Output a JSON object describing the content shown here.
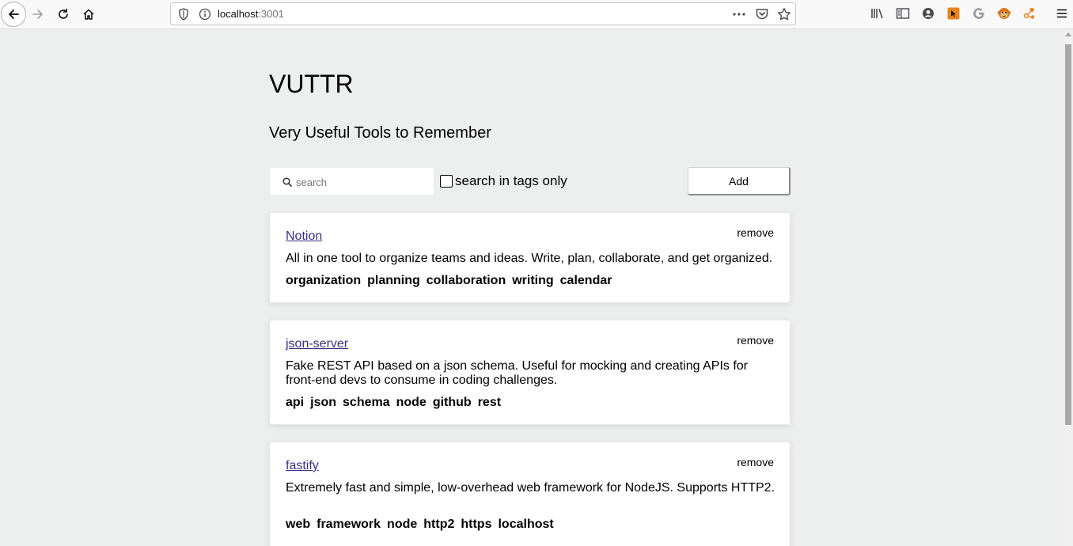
{
  "browser": {
    "url_host": "localhost",
    "url_port": ":3001"
  },
  "page": {
    "title": "VUTTR",
    "subtitle": "Very Useful Tools to Remember"
  },
  "controls": {
    "search_placeholder": "search",
    "tags_only_label": "search in tags only",
    "tags_only_checked": false,
    "add_label": "Add"
  },
  "tools": [
    {
      "name": "Notion",
      "remove_label": "remove",
      "description": "All in one tool to organize teams and ideas. Write, plan, collaborate, and get organized.",
      "tags": [
        "organization",
        "planning",
        "collaboration",
        "writing",
        "calendar"
      ]
    },
    {
      "name": "json-server",
      "remove_label": "remove",
      "description": "Fake REST API based on a json schema. Useful for mocking and creating APIs for front-end devs to consume in coding challenges.",
      "tags": [
        "api",
        "json",
        "schema",
        "node",
        "github",
        "rest"
      ]
    },
    {
      "name": "fastify",
      "remove_label": "remove",
      "description": "Extremely fast and simple, low-overhead web framework for NodeJS. Supports HTTP2.",
      "tags": [
        "web",
        "framework",
        "node",
        "http2",
        "https",
        "localhost"
      ]
    }
  ],
  "colors": {
    "background": "#edeeee",
    "link": "#3b2f7f",
    "card": "#ffffff"
  }
}
